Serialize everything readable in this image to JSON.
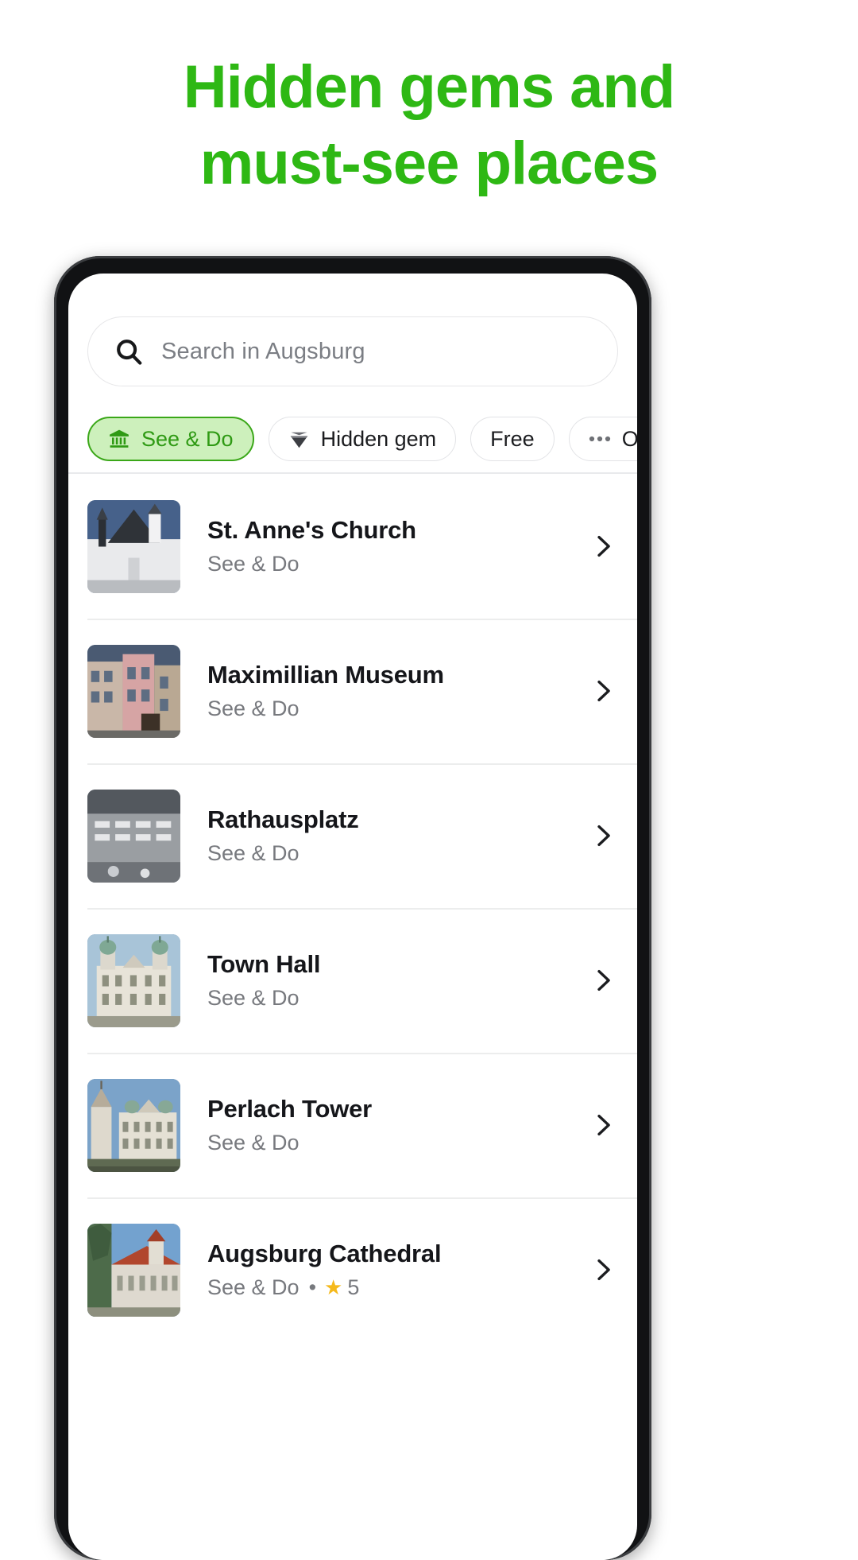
{
  "headline": {
    "line1": "Hidden gems and",
    "line2": "must-see places",
    "color": "#2eb814"
  },
  "search": {
    "placeholder": "Search in Augsburg",
    "icon": "search-icon"
  },
  "filters": [
    {
      "label": "See & Do",
      "icon": "museum-icon",
      "active": true
    },
    {
      "label": "Hidden gem",
      "icon": "diamond-icon",
      "active": false
    },
    {
      "label": "Free",
      "icon": "",
      "active": false
    },
    {
      "label": "Other",
      "icon": "ellipsis-icon",
      "active": false
    }
  ],
  "places": [
    {
      "title": "St. Anne's Church",
      "subtitle": "See & Do",
      "rating": "",
      "chevron": "chevron-right-icon"
    },
    {
      "title": "Maximillian Museum",
      "subtitle": "See & Do",
      "rating": "",
      "chevron": "chevron-right-icon"
    },
    {
      "title": "Rathausplatz",
      "subtitle": "See & Do",
      "rating": "",
      "chevron": "chevron-right-icon"
    },
    {
      "title": "Town Hall",
      "subtitle": "See & Do",
      "rating": "",
      "chevron": "chevron-right-icon"
    },
    {
      "title": "Perlach Tower",
      "subtitle": "See & Do",
      "rating": "",
      "chevron": "chevron-right-icon"
    },
    {
      "title": "Augsburg Cathedral",
      "subtitle": "See & Do",
      "rating": "5",
      "separator": "•",
      "chevron": "chevron-right-icon"
    }
  ],
  "colors": {
    "accent_green": "#2eb814",
    "chip_active_bg": "#cdf0bc",
    "chip_active_text": "#2f9a14",
    "star": "#f5b91c",
    "title": "#15161a",
    "subtitle": "#77797e"
  }
}
